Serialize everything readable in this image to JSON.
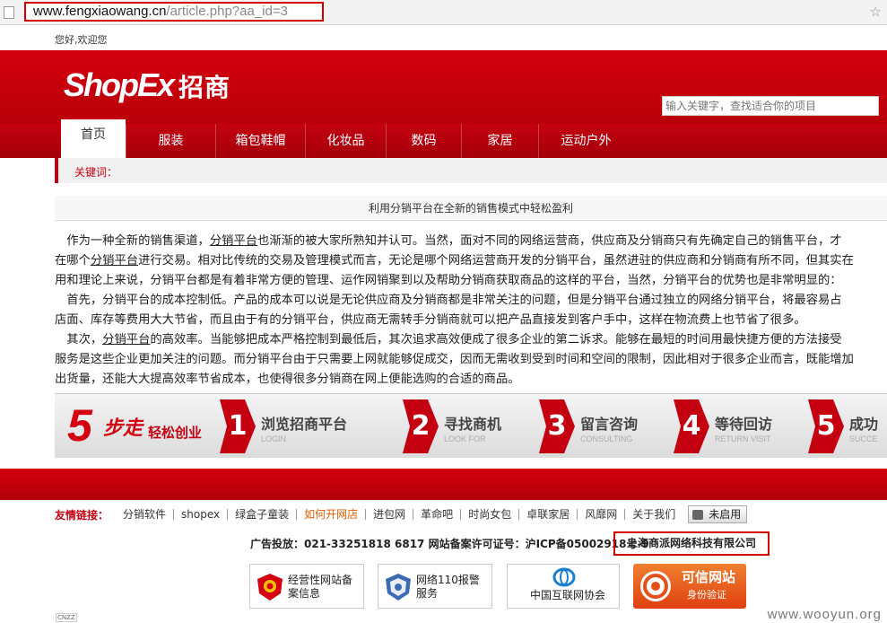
{
  "browser": {
    "url_domain": "www.fengxiaowang.cn",
    "url_path": "/article.php?aa_id=3"
  },
  "greeting": "您好,欢迎您",
  "header": {
    "logo_text": "ShopEx",
    "logo_cn": "招商",
    "search_placeholder": "输入关键字，查找适合你的项目"
  },
  "nav": {
    "items": [
      "首页",
      "服装",
      "箱包鞋帽",
      "化妆品",
      "数码",
      "家居",
      "运动户外"
    ]
  },
  "keywords_label": "关键词：",
  "article": {
    "title": "利用分销平台在全新的销售模式中轻松盈利",
    "lines": [
      [
        "　作为一种全新的销售渠道，",
        "分销平台",
        "也渐渐的被大家所熟知并认可。当然，面对不同的网络运营商，供应商及分销商只有先确定自己的销售平台，才"
      ],
      [
        "在哪个",
        "分销平台",
        "进行交易。相对比传统的交易及管理模式而言，无论是哪个网络运营商开发的分销平台，虽然进驻的供应商和分销商有所不同，但其实在"
      ],
      [
        "用和理论上来说，分销平台都是有着非常方便的管理、运作网销聚到以及帮助分销商获取商品的这样的平台，当然，分销平台的优势也是非常明显的：",
        "",
        ""
      ],
      [
        "　首先，分销平台的成本控制低。产品的成本可以说是无论供应商及分销商都是非常关注的问题，但是分销平台通过独立的网络分销平台，将最容易占",
        "",
        ""
      ],
      [
        "店面、库存等费用大大节省，而且由于有的分销平台，供应商无需转手分销商就可以把产品直接发到客户手中，这样在物流费上也节省了很多。",
        "",
        ""
      ],
      [
        "　其次，",
        "分销平台",
        "的高效率。当能够把成本严格控制到最低后，其次追求高效便成了很多企业的第二诉求。能够在最短的时间用最快捷方便的方法接受"
      ],
      [
        "服务是这些企业更加关注的问题。而分销平台由于只需要上网就能够促成交，因而无需收到受到时间和空间的限制，因此相对于很多企业而言，既能增加",
        "",
        ""
      ],
      [
        "出货量，还能大大提高效率节省成本，也使得很多分销商在网上便能选购的合适的商品。",
        "",
        ""
      ]
    ]
  },
  "steps_banner": {
    "five": "5",
    "bu": "步走",
    "slogan": "轻松创业",
    "steps": [
      {
        "num": "1",
        "title": "浏览招商平台",
        "en": "LOGIN"
      },
      {
        "num": "2",
        "title": "寻找商机",
        "en": "LOOK FOR"
      },
      {
        "num": "3",
        "title": "留言咨询",
        "en": "CONSULTING"
      },
      {
        "num": "4",
        "title": "等待回访",
        "en": "RETURN VISIT"
      },
      {
        "num": "5",
        "title": "成功",
        "en": "SUCCE"
      }
    ]
  },
  "friend_links": {
    "label": "友情链接：",
    "items": [
      "分销软件",
      "shopex",
      "绿盒子童装",
      "如何开网店",
      "进包网",
      "革命吧",
      "时尚女包",
      "卓联家居",
      "风靡网",
      "关于我们"
    ],
    "highlight_index": 3,
    "ie_button": "未启用"
  },
  "record": {
    "text": "广告投放：021-33251818 6817 网站备案许可证号：沪ICP备05002918号-9",
    "company": "上海商派网络科技有限公司"
  },
  "badges": [
    {
      "text1": "经营性网站备",
      "text2": "案信息",
      "icon": "police-shield-icon"
    },
    {
      "text1": "网络110报警",
      "text2": "服务",
      "icon": "police-badge-icon"
    },
    {
      "text1": "中国互联网协会",
      "icon": "isc-logo-icon"
    },
    {
      "text1": "可信网站",
      "text2": "身份验证",
      "icon": "trust-seal-icon",
      "color": "#e65016"
    }
  ],
  "watermark": "www.wooyun.org",
  "small_icon_text": "CNZZ",
  "colors": {
    "brand_red": "#c40010",
    "highlight_red": "#d40000",
    "link_orange": "#e05a00"
  }
}
